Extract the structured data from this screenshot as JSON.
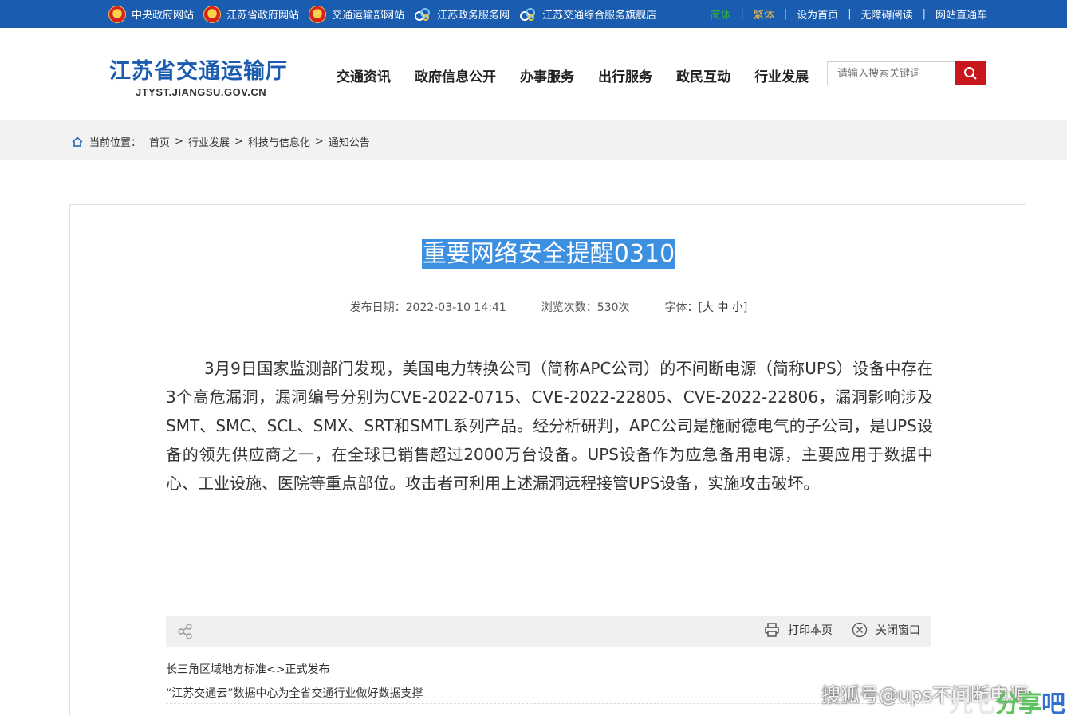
{
  "topbar": {
    "links": [
      {
        "label": "中央政府网站",
        "icon": "national-emblem-icon"
      },
      {
        "label": "江苏省政府网站",
        "icon": "national-emblem-icon"
      },
      {
        "label": "交通运输部网站",
        "icon": "national-emblem-icon"
      },
      {
        "label": "江苏政务服务网",
        "icon": "swirl-logo-icon"
      },
      {
        "label": "江苏交通综合服务旗舰店",
        "icon": "swirl-logo-icon"
      }
    ],
    "right": {
      "simplified": "简体",
      "traditional": "繁体",
      "set_home": "设为首页",
      "accessible": "无障碍阅读",
      "site_nav": "网站直通车"
    }
  },
  "header": {
    "site_title": "江苏省交通运输厅",
    "domain": "JTYST.JIANGSU.GOV.CN",
    "nav": [
      "交通资讯",
      "政府信息公开",
      "办事服务",
      "出行服务",
      "政民互动",
      "行业发展"
    ],
    "search_placeholder": "请输入搜索关键词"
  },
  "breadcrumb": {
    "label": "当前位置：",
    "items": [
      "首页",
      "行业发展",
      "科技与信息化",
      "通知公告"
    ],
    "separator": ">"
  },
  "article": {
    "title": "重要网络安全提醒0310",
    "publish_date": "发布日期：2022-03-10 14:41",
    "views": "浏览次数：530次",
    "font_label": "字体：[",
    "font_large": "大",
    "font_medium": "中",
    "font_small": "小",
    "font_close": "]",
    "body": "3月9日国家监测部门发现，美国电力转换公司（简称APC公司）的不间断电源（简称UPS）设备中存在3个高危漏洞，漏洞编号分别为CVE-2022-0715、CVE-2022-22805、CVE-2022-22806，漏洞影响涉及SMT、SMC、SCL、SMX、SRT和SMTL系列产品。经分析研判，APC公司是施耐德电气的子公司，是UPS设备的领先供应商之一，在全球已销售超过2000万台设备。UPS设备作为应急备用电源，主要应用于数据中心、工业设施、医院等重点部位。攻击者可利用上述漏洞远程接管UPS设备，实施攻击破坏。"
  },
  "toolbar": {
    "print": "打印本页",
    "close": "关闭窗口"
  },
  "related": [
    "长三角区域地方标准<>正式发布",
    "“江苏交通云”数据中心为全省交通行业做好数据支撑"
  ],
  "watermark": {
    "sohu": "搜狐号@ups不间断电源",
    "site_a": "九七",
    "site_b": "分享",
    "site_c": "吧"
  },
  "colors": {
    "topbar": "#1a5cb0",
    "brand_blue": "#1a5cb0",
    "search_red": "#c8161d",
    "title_highlight": "#3d8fe0"
  }
}
